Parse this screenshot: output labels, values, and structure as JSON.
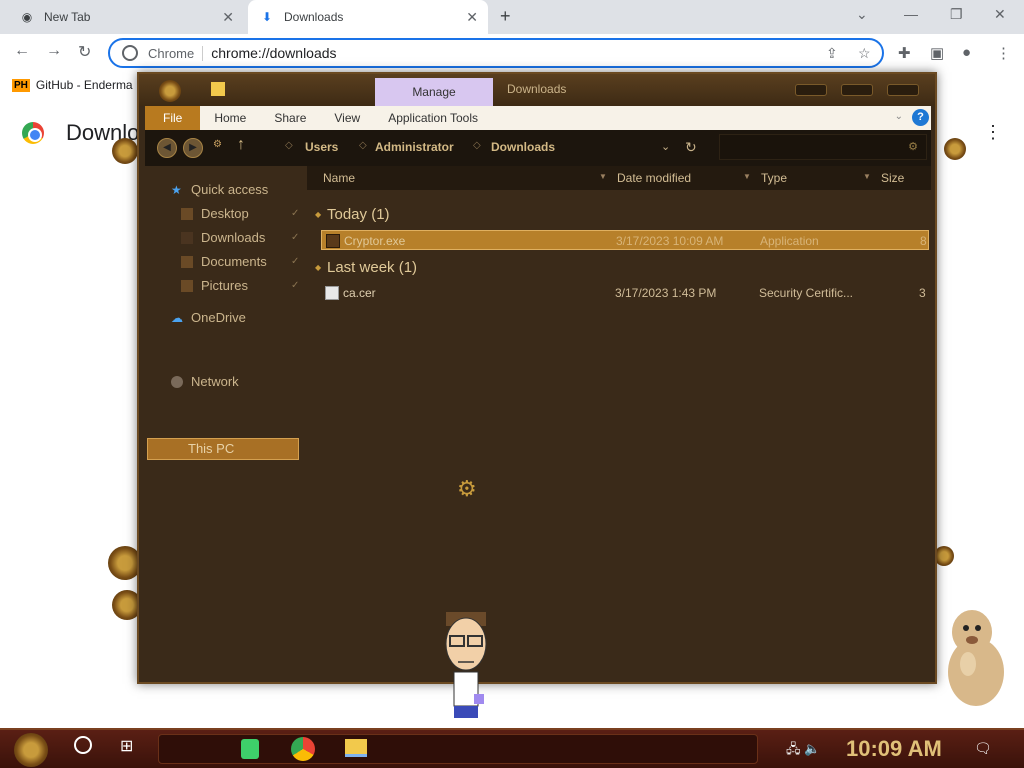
{
  "browser": {
    "tabs": [
      {
        "label": "New Tab",
        "icon": "chrome-icon"
      },
      {
        "label": "Downloads",
        "icon": "download-icon"
      }
    ],
    "omnibox": {
      "chip": "Chrome",
      "url": "chrome://downloads"
    },
    "bookmarks": [
      {
        "badge": "PH",
        "label": "GitHub - Enderma"
      }
    ],
    "page_title": "Downloads"
  },
  "explorer": {
    "title": "Downloads",
    "manage_label": "Manage",
    "ribbon_tabs": [
      "File",
      "Home",
      "Share",
      "View",
      "Application Tools"
    ],
    "breadcrumb": [
      "Users",
      "Administrator",
      "Downloads"
    ],
    "nav": {
      "quick_access": "Quick access",
      "desktop": "Desktop",
      "downloads": "Downloads",
      "documents": "Documents",
      "pictures": "Pictures",
      "onedrive": "OneDrive",
      "this_pc": "This PC",
      "network": "Network"
    },
    "columns": {
      "name": "Name",
      "date": "Date modified",
      "type": "Type",
      "size": "Size"
    },
    "groups": {
      "today": "Today (1)",
      "last_week": "Last week (1)"
    },
    "files": [
      {
        "name": "Cryptor.exe",
        "date": "3/17/2023 10:09 AM",
        "type": "Application",
        "size": "8"
      },
      {
        "name": "ca.cer",
        "date": "3/17/2023 1:43 PM",
        "type": "Security Certific...",
        "size": "3"
      }
    ]
  },
  "taskbar": {
    "clock": "10:09 AM"
  },
  "colors": {
    "accent": "#1a73e8",
    "explorer_bg": "#3a2a19",
    "selection": "#b7802a",
    "taskbar": "#4a160c"
  }
}
